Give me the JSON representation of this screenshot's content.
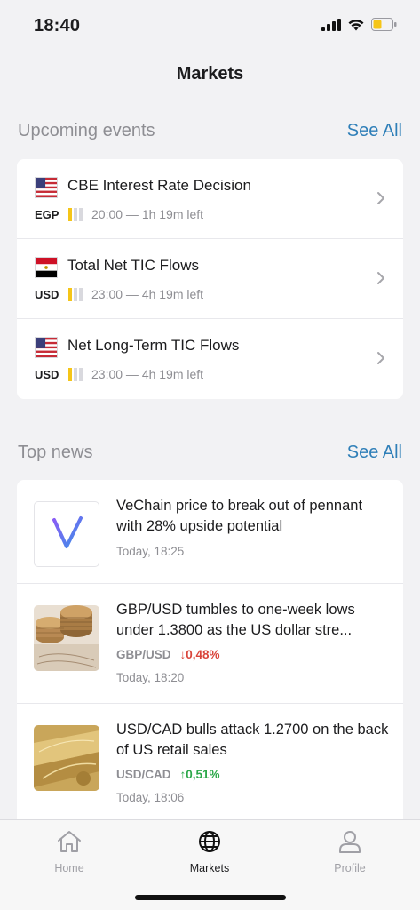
{
  "status": {
    "time": "18:40"
  },
  "nav": {
    "title": "Markets"
  },
  "events": {
    "section_title": "Upcoming events",
    "see_all": "See All",
    "items": [
      {
        "flag": "us-flag",
        "title": "CBE Interest Rate Decision",
        "currency": "EGP",
        "impact": 1,
        "time": "20:00 — 1h 19m left"
      },
      {
        "flag": "egypt-flag",
        "title": "Total Net TIC Flows",
        "currency": "USD",
        "impact": 1,
        "time": "23:00 — 4h 19m left"
      },
      {
        "flag": "us-flag",
        "title": "Net Long-Term TIC Flows",
        "currency": "USD",
        "impact": 1,
        "time": "23:00 — 4h 19m left"
      }
    ]
  },
  "news": {
    "section_title": "Top news",
    "see_all": "See All",
    "items": [
      {
        "title": "VeChain price to break out of pennant with 28% upside potential",
        "time": "Today, 18:25"
      },
      {
        "title": "GBP/USD tumbles to one-week lows under 1.3800 as the US dollar stre...",
        "pair": "GBP/USD",
        "change": "0,48%",
        "direction": "down",
        "time": "Today, 18:20"
      },
      {
        "title": "USD/CAD bulls attack 1.2700 on the back of US retail sales",
        "pair": "USD/CAD",
        "change": "0,51%",
        "direction": "up",
        "time": "Today, 18:06"
      }
    ]
  },
  "tabs": [
    {
      "label": "Home",
      "icon": "home-icon",
      "active": false
    },
    {
      "label": "Markets",
      "icon": "globe-icon",
      "active": true
    },
    {
      "label": "Profile",
      "icon": "person-icon",
      "active": false
    }
  ],
  "colors": {
    "accent": "#2f7fb8",
    "impact": "#f5c518",
    "down": "#d9443a",
    "up": "#2ca84a"
  }
}
